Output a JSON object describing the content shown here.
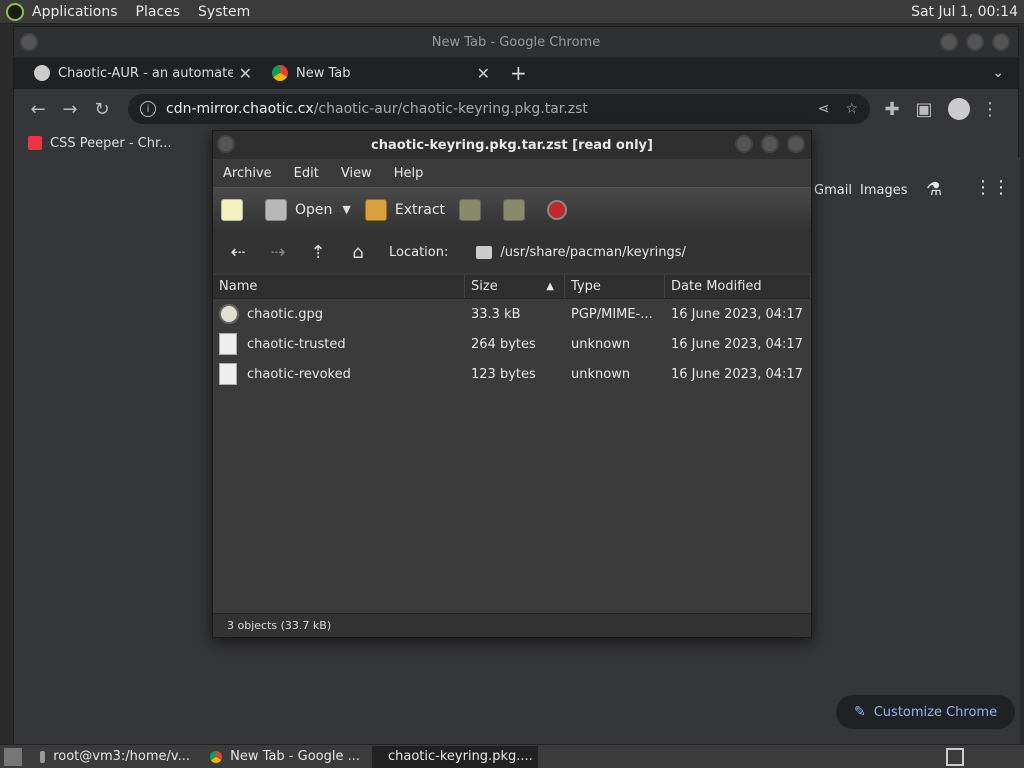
{
  "top_panel": {
    "menus": [
      "Applications",
      "Places",
      "System"
    ],
    "clock": "Sat Jul 1, 00:14"
  },
  "chrome": {
    "window_title": "New Tab - Google Chrome",
    "tabs": [
      {
        "label": "Chaotic-AUR - an automated |"
      },
      {
        "label": "New Tab"
      }
    ],
    "omnibox": {
      "host": "cdn-mirror.chaotic.cx",
      "path": "/chaotic-aur/chaotic-keyring.pkg.tar.zst"
    },
    "bookmarks": [
      {
        "label": "CSS Peeper - Chr..."
      }
    ],
    "ntp": {
      "gmail": "Gmail",
      "images": "Images",
      "customize": "Customize Chrome"
    }
  },
  "file_roller": {
    "title": "chaotic-keyring.pkg.tar.zst [read only]",
    "menus": [
      "Archive",
      "Edit",
      "View",
      "Help"
    ],
    "toolbar": {
      "open": "Open",
      "extract": "Extract"
    },
    "location_label": "Location:",
    "location_path": "/usr/share/pacman/keyrings/",
    "columns": {
      "name": "Name",
      "size": "Size",
      "type": "Type",
      "date": "Date Modified"
    },
    "files": [
      {
        "name": "chaotic.gpg",
        "size": "33.3 kB",
        "type": "PGP/MIME-...",
        "date": "16 June 2023, 04:17"
      },
      {
        "name": "chaotic-trusted",
        "size": "264 bytes",
        "type": "unknown",
        "date": "16 June 2023, 04:17"
      },
      {
        "name": "chaotic-revoked",
        "size": "123 bytes",
        "type": "unknown",
        "date": "16 June 2023, 04:17"
      }
    ],
    "status": "3 objects (33.7 kB)"
  },
  "taskbar": {
    "items": [
      {
        "label": "root@vm3:/home/v..."
      },
      {
        "label": "New Tab - Google ..."
      },
      {
        "label": "chaotic-keyring.pkg...."
      }
    ]
  }
}
